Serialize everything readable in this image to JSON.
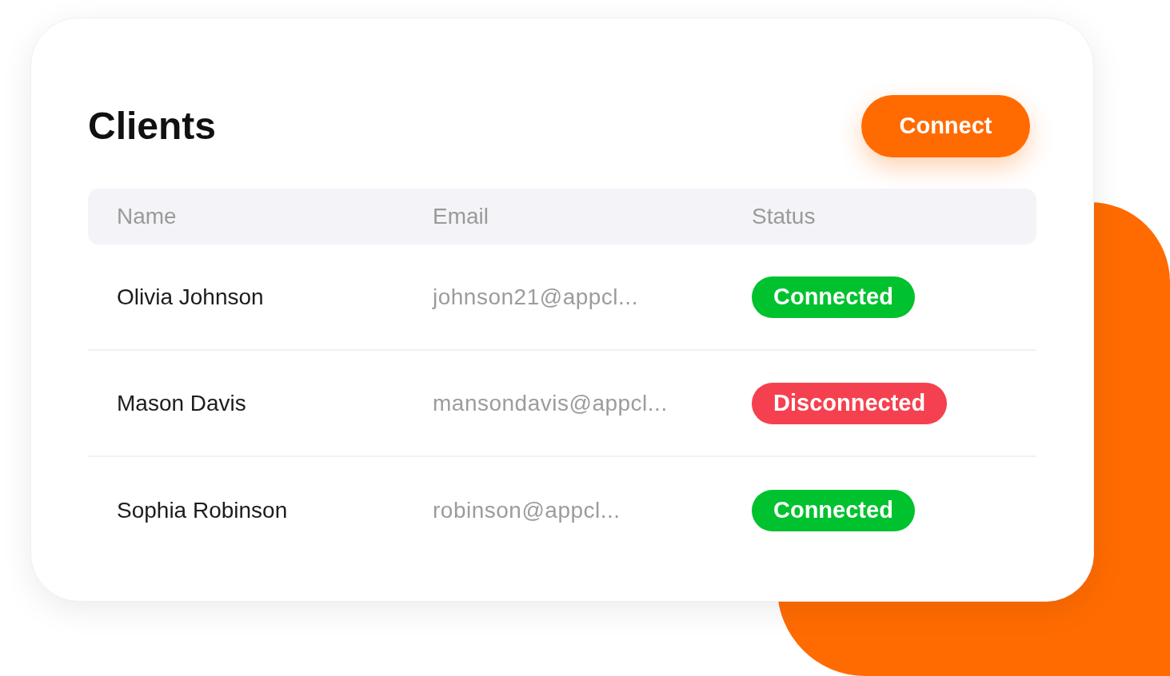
{
  "title": "Clients",
  "connect_button": "Connect",
  "table": {
    "columns": [
      "Name",
      "Email",
      "Status"
    ],
    "rows": [
      {
        "name": "Olivia Johnson",
        "email": "johnson21@appcl...",
        "status": {
          "label": "Connected",
          "kind": "connected"
        }
      },
      {
        "name": "Mason Davis",
        "email": "mansondavis@appcl...",
        "status": {
          "label": "Disconnected",
          "kind": "disconnected"
        }
      },
      {
        "name": "Sophia Robinson",
        "email": "robinson@appcl...",
        "status": {
          "label": "Connected",
          "kind": "connected"
        }
      }
    ]
  }
}
